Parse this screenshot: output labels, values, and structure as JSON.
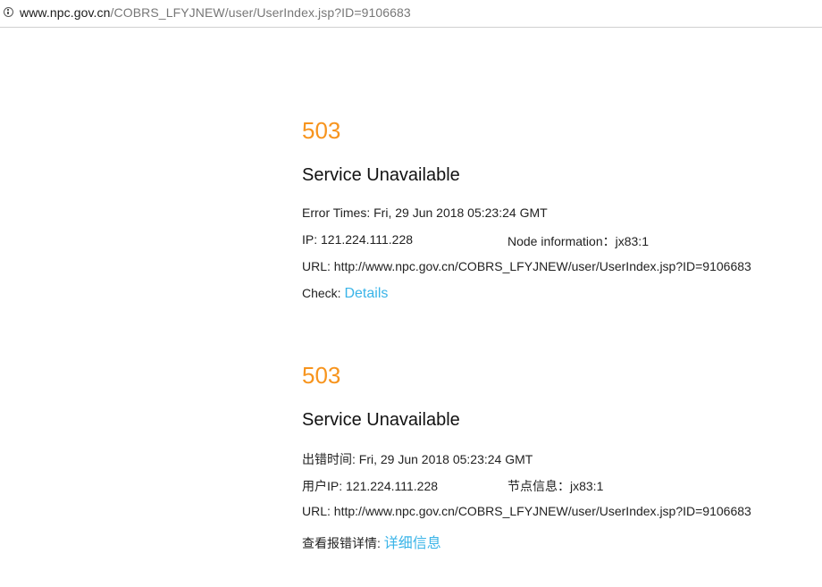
{
  "browser": {
    "url_host": "www.npc.gov.cn",
    "url_path": "/COBRS_LFYJNEW/user/UserIndex.jsp?ID=9106683"
  },
  "colors": {
    "error_code": "#f7941d",
    "link": "#3ab4e8"
  },
  "error_en": {
    "code": "503",
    "title": "Service Unavailable",
    "time_label": "Error Times:",
    "time_value": "Fri, 29 Jun 2018 05:23:24 GMT",
    "ip_label": "IP:",
    "ip_value": "121.224.111.228",
    "node_label": "Node information：",
    "node_value": "jx83:1",
    "url_label": "URL:",
    "url_value": "http://www.npc.gov.cn/COBRS_LFYJNEW/user/UserIndex.jsp?ID=9106683",
    "check_label": "Check:",
    "check_link": "Details"
  },
  "error_cn": {
    "code": "503",
    "title": "Service Unavailable",
    "time_label": "出错时间:",
    "time_value": "Fri, 29 Jun 2018 05:23:24 GMT",
    "ip_label": "用户IP:",
    "ip_value": "121.224.111.228",
    "node_label": "节点信息：",
    "node_value": "jx83:1",
    "url_label": "URL:",
    "url_value": "http://www.npc.gov.cn/COBRS_LFYJNEW/user/UserIndex.jsp?ID=9106683",
    "check_label": "查看报错详情:",
    "check_link": "详细信息"
  }
}
